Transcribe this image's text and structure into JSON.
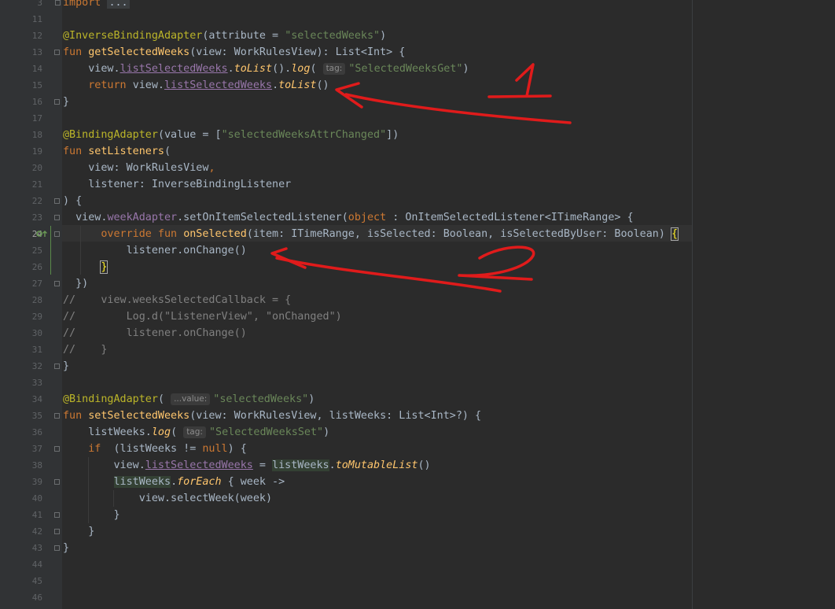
{
  "gutter": {
    "lines": [
      "3",
      "11",
      "12",
      "13",
      "14",
      "15",
      "16",
      "17",
      "18",
      "19",
      "20",
      "21",
      "22",
      "23",
      "24",
      "25",
      "26",
      "27",
      "28",
      "29",
      "30",
      "31",
      "32",
      "33",
      "34",
      "35",
      "36",
      "37",
      "38",
      "39",
      "40",
      "41",
      "42",
      "43",
      "44",
      "45",
      "46"
    ]
  },
  "code": {
    "l3_import": "import",
    "l3_folded": "...",
    "l12_ann": "@InverseBindingAdapter",
    "l12_a": "(attribute = ",
    "l12_str": "\"selectedWeeks\"",
    "l12_b": ")",
    "l13_fun": "fun ",
    "l13_name": "getSelectedWeeks",
    "l13_rest": "(view: WorkRulesView): List<Int> {",
    "l14_a": "    view.",
    "l14_prop": "listSelectedWeeks",
    "l14_dot": ".",
    "l14_tolist": "toList",
    "l14_b": "().",
    "l14_log": "log",
    "l14_c": "( ",
    "l14_hint": "tag:",
    "l14_str": "\"SelectedWeeksGet\"",
    "l14_d": ")",
    "l15_ret": "    return ",
    "l15_a": "view.",
    "l15_prop": "listSelectedWeeks",
    "l15_dot": ".",
    "l15_tolist": "toList",
    "l15_b": "()",
    "l16": "}",
    "l18_ann": "@BindingAdapter",
    "l18_a": "(value = [",
    "l18_str": "\"selectedWeeksAttrChanged\"",
    "l18_b": "])",
    "l19_fun": "fun ",
    "l19_name": "setListeners",
    "l19_rest": "(",
    "l20_a": "    view: WorkRulesView",
    "l20_comma": ",",
    "l21": "    listener: InverseBindingListener",
    "l22": ") {",
    "l23_a": "  view.",
    "l23_prop": "weekAdapter",
    "l23_b": ".setOnItemSelectedListener(",
    "l23_obj": "object",
    "l23_c": " : OnItemSelectedListener<ITimeRange> {",
    "l24_override": "      override fun ",
    "l24_name": "onSelected",
    "l24_rest": "(item: ITimeRange, isSelected: Boolean, isSelectedByUser: Boolean) ",
    "l24_brace": "{",
    "l25": "          listener.onChange()",
    "l26_pad": "      ",
    "l26_brace": "}",
    "l27": "  })",
    "l28": "//    view.weeksSelectedCallback = {",
    "l29": "//        Log.d(\"ListenerView\", \"onChanged\")",
    "l30": "//        listener.onChange()",
    "l31": "//    }",
    "l32": "}",
    "l34_ann": "@BindingAdapter",
    "l34_a": "( ",
    "l34_hint": "...value:",
    "l34_str": "\"selectedWeeks\"",
    "l34_b": ")",
    "l35_fun": "fun ",
    "l35_name": "setSelectedWeeks",
    "l35_rest": "(view: WorkRulesView, listWeeks: List<Int>?) {",
    "l36_a": "    listWeeks.",
    "l36_log": "log",
    "l36_b": "( ",
    "l36_hint": "tag:",
    "l36_str": "\"SelectedWeeksSet\"",
    "l36_c": ")",
    "l37_if": "    if ",
    "l37_a": " (listWeeks != ",
    "l37_null": "null",
    "l37_b": ") {",
    "l38_a": "        view.",
    "l38_prop": "listSelectedWeeks",
    "l38_b": " = ",
    "l38_hl": "listWeeks",
    "l38_dot": ".",
    "l38_ext": "toMutableList",
    "l38_c": "()",
    "l39_pad": "        ",
    "l39_hl": "listWeeks",
    "l39_dot": ".",
    "l39_ext": "forEach",
    "l39_b": " { week ->",
    "l40": "            view.selectWeek(week)",
    "l41": "        }",
    "l42": "    }",
    "l43": "}"
  },
  "annotations": {
    "mark_1": "1",
    "mark_2": "2",
    "color": "#e01b1b"
  }
}
